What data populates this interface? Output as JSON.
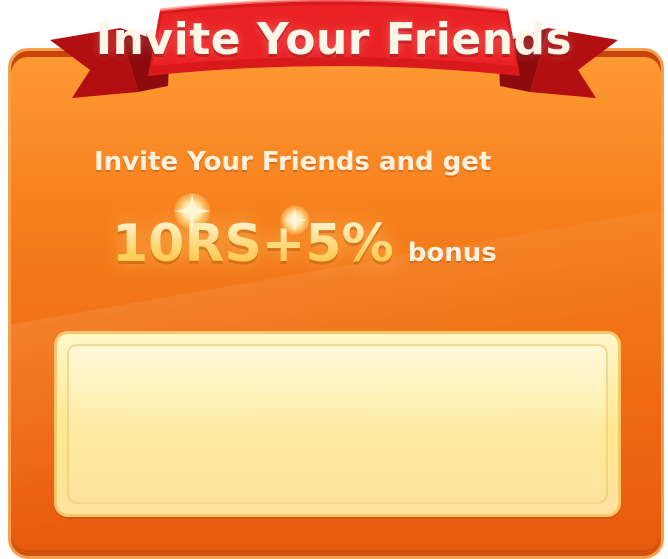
{
  "banner": {
    "title": "Invite Your Friends"
  },
  "content": {
    "subtitle": "Invite Your Friends and get",
    "bonus_amount": "10RS+5%",
    "bonus_suffix": "bonus"
  },
  "colors": {
    "card_orange": "#f57d1a",
    "ribbon_red": "#d9191b",
    "panel_yellow": "#ffe78e"
  },
  "icons": {
    "sparkle": "sparkle-icon"
  }
}
